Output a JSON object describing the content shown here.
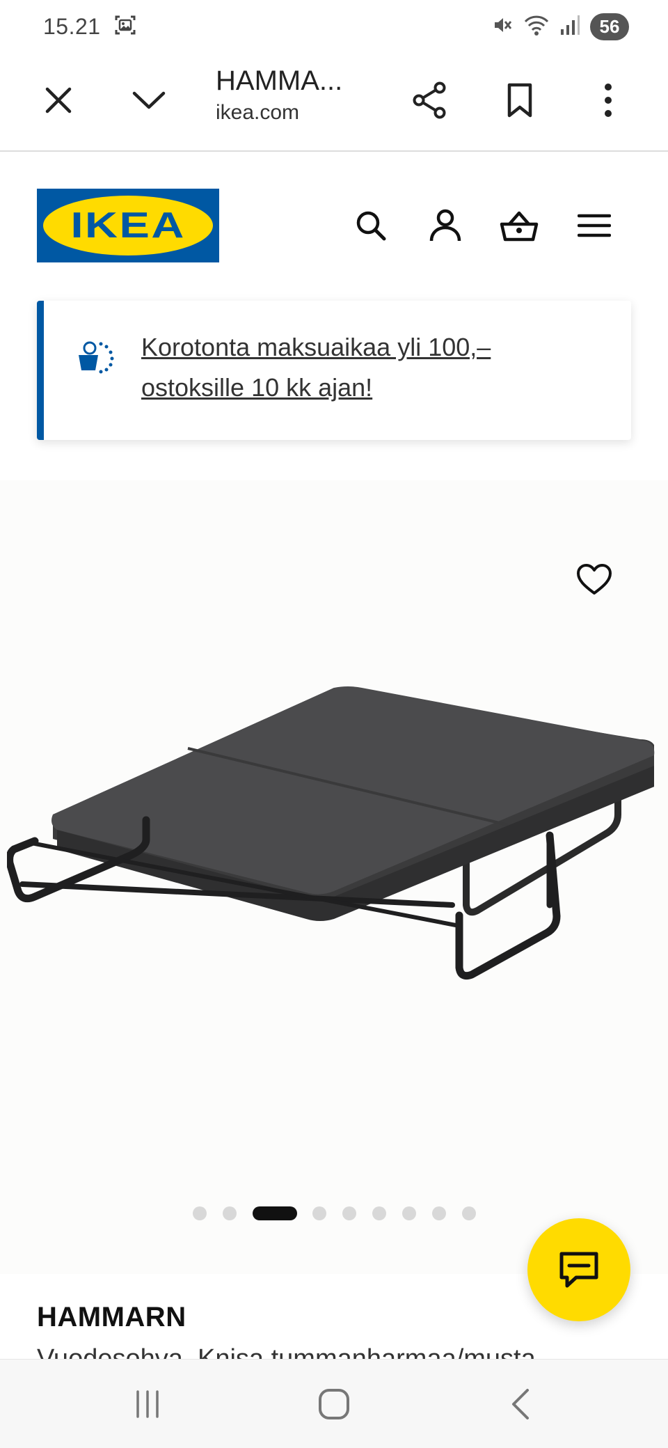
{
  "status_bar": {
    "time": "15.21",
    "battery": "56"
  },
  "toolbar": {
    "title": "HAMMA...",
    "url": "ikea.com"
  },
  "header": {
    "logo_text": "IKEA"
  },
  "promo": {
    "text": "Korotonta maksuaikaa yli 100,– ostoksille 10 kk ajan!"
  },
  "gallery": {
    "image_count": 9,
    "active_index": 2
  },
  "product": {
    "name": "HAMMARN",
    "description": "Vuodesohva, Knisa tummanharmaa/musta"
  },
  "colors": {
    "ikea_blue": "#0058a3",
    "ikea_yellow": "#ffdb00"
  }
}
